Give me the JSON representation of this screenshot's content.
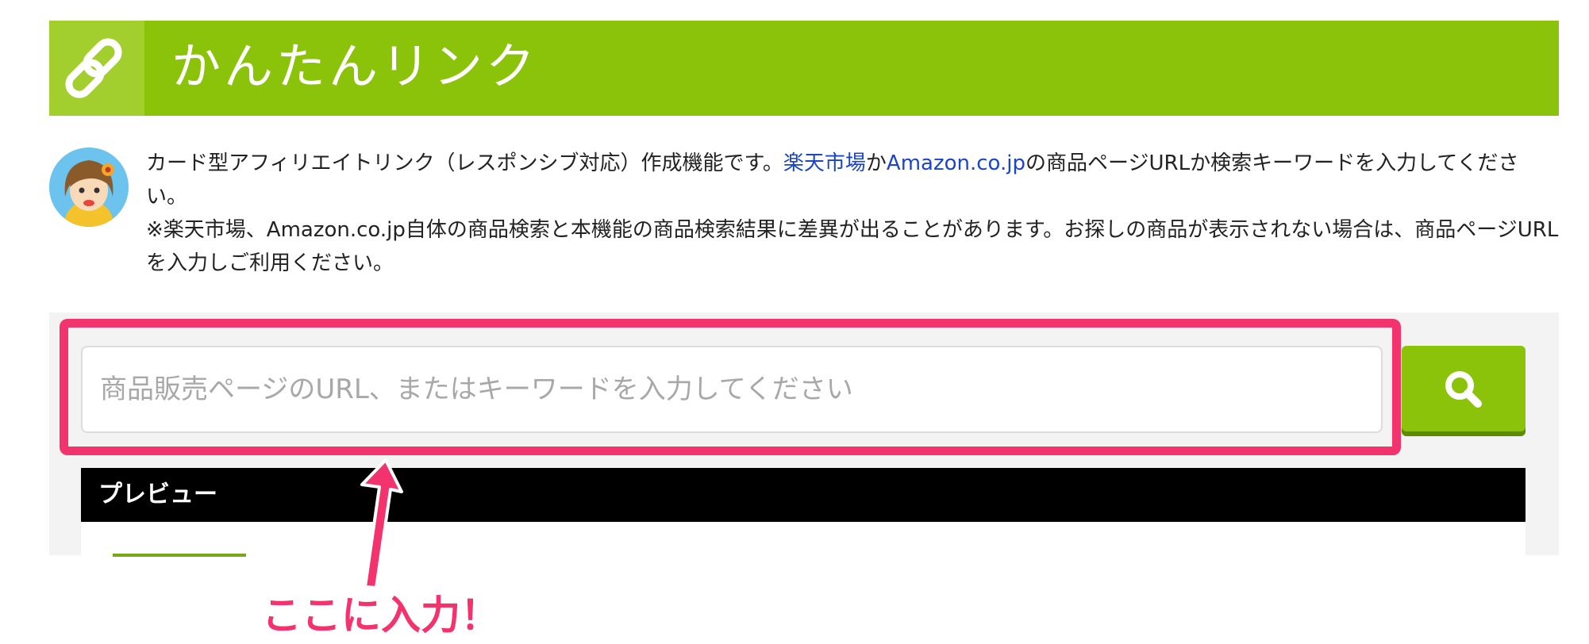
{
  "header": {
    "title": "かんたんリンク",
    "icon": "link-icon",
    "color": "#8bc20a"
  },
  "description": {
    "line1_text": "カード型アフィリエイトリンク（レスポンシブ対応）作成機能です。",
    "rakuten_link": "楽天市場",
    "connector": "か",
    "amazon_link": "Amazon.co.jp",
    "line1_tail": "の商品ページURLか検索キーワードを入力してください。",
    "note": "※楽天市場、Amazon.co.jp自体の商品検索と本機能の商品検索結果に差異が出ることがあります。お探しの商品が表示されない場合は、商品ページURLを入力しご利用ください。",
    "link_color": "#1a45c8"
  },
  "search": {
    "placeholder": "商品販売ページのURL、またはキーワードを入力してください",
    "value": "",
    "button_icon": "search-icon"
  },
  "preview": {
    "label": "プレビュー"
  },
  "annotation": {
    "text": "ここに入力！",
    "color": "#f2336d"
  }
}
